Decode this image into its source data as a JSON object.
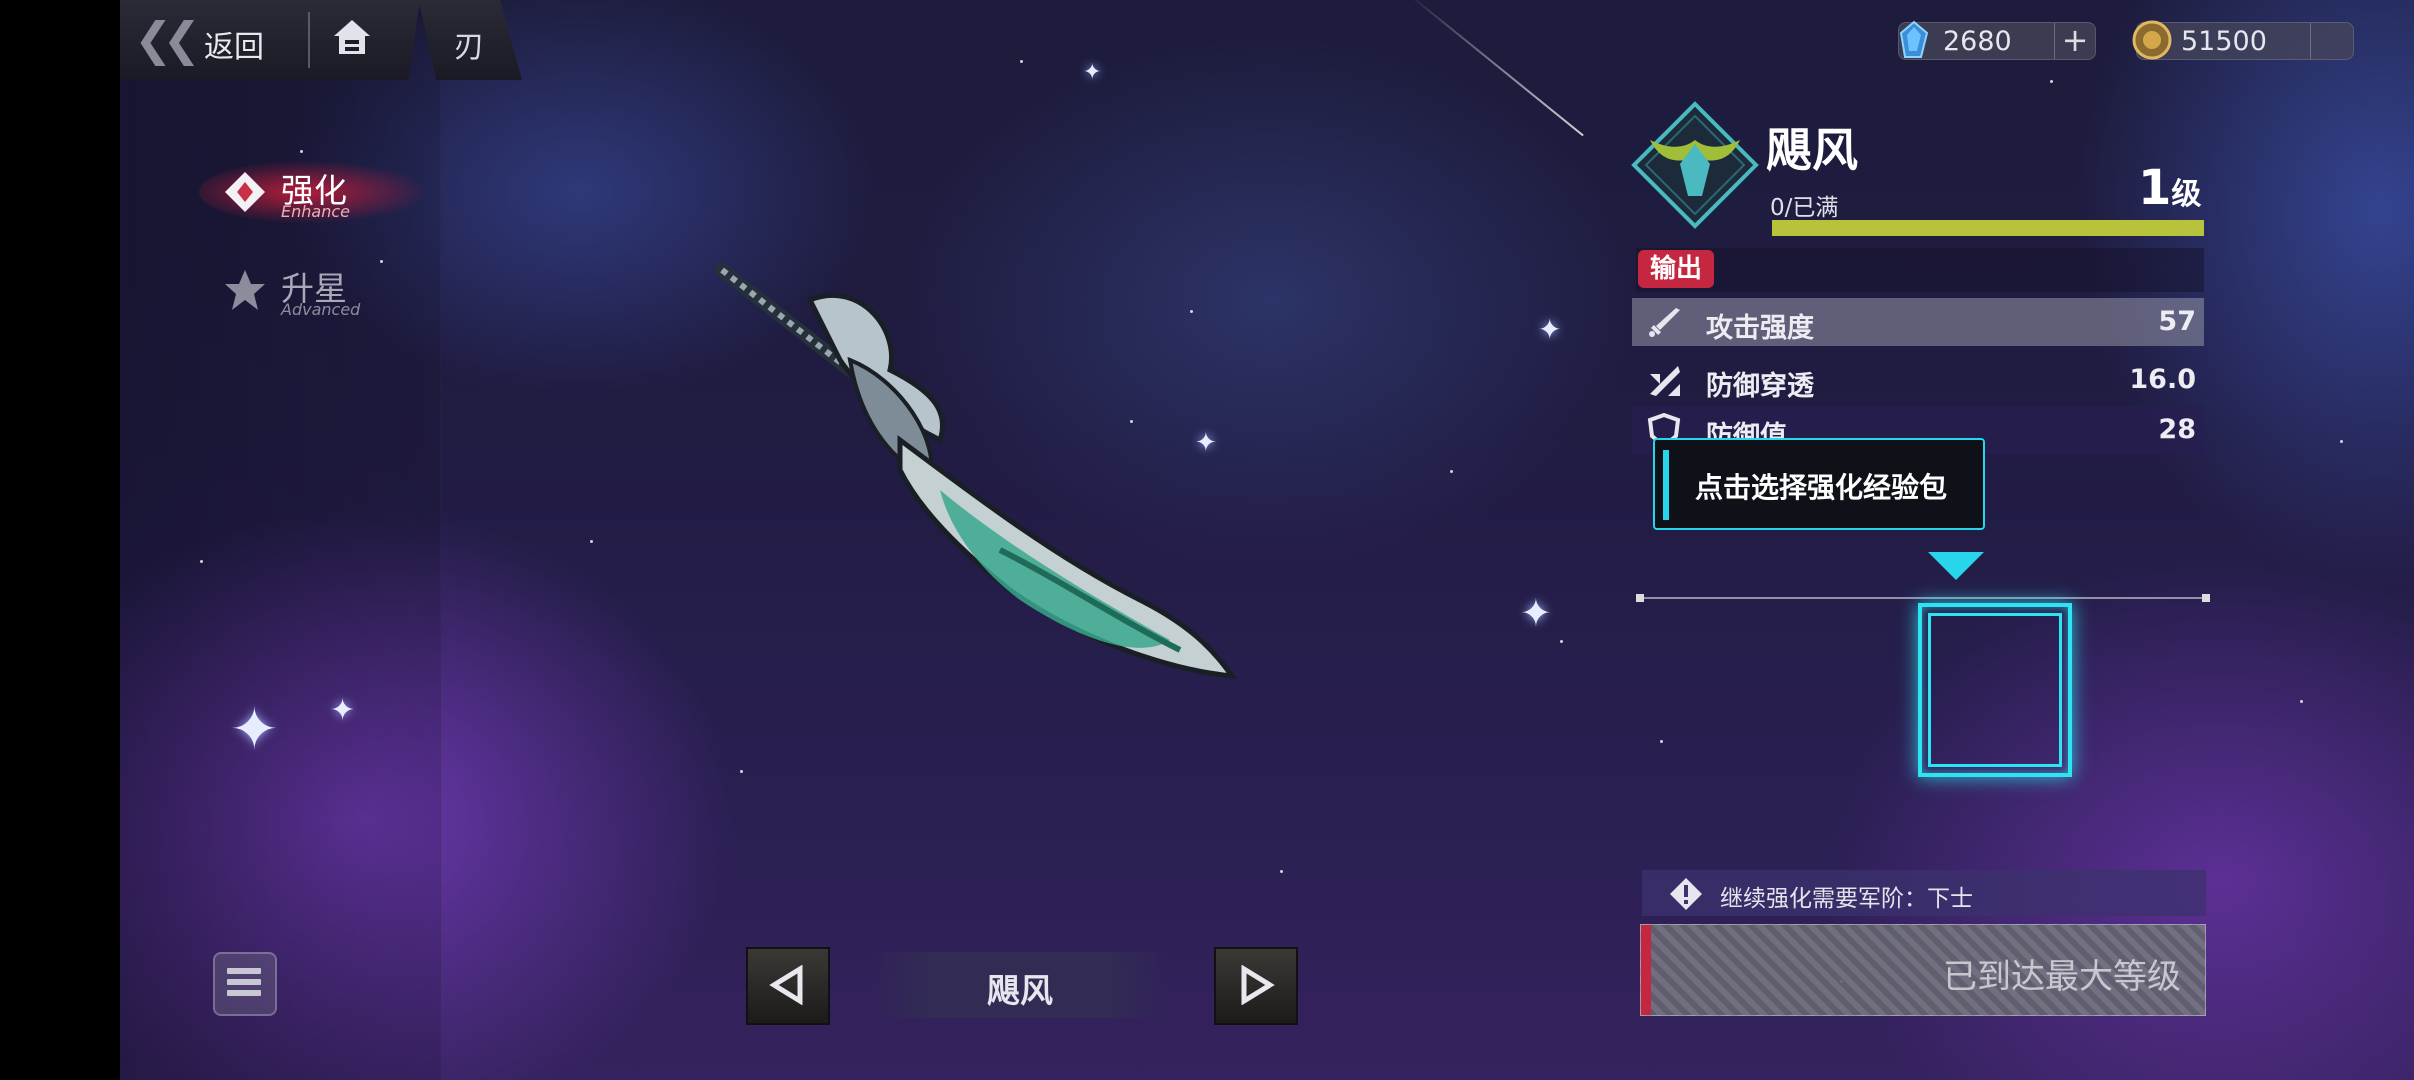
{
  "nav": {
    "back_label": "返回",
    "title": "刃"
  },
  "currencies": [
    {
      "icon": "crystal-icon",
      "value": "2680"
    },
    {
      "icon": "coin-icon",
      "value": "51500"
    }
  ],
  "tabs": [
    {
      "label_zh": "强化",
      "label_en": "Enhance",
      "active": true
    },
    {
      "label_zh": "升星",
      "label_en": "Advanced",
      "active": false
    }
  ],
  "weapon": {
    "name": "飓风",
    "exp_text": "0/已满",
    "level": "1",
    "level_suffix": "级",
    "exp_fill": 1.0,
    "role": "输出",
    "stats": [
      {
        "name": "攻击强度",
        "value": "57",
        "icon": "sword-icon"
      },
      {
        "name": "防御穿透",
        "value": "16.0",
        "icon": "pierce-icon"
      },
      {
        "name": "防御值",
        "value": "28",
        "icon": "shield-icon"
      }
    ]
  },
  "tooltip": "点击选择强化经验包",
  "requirement": "继续强化需要军阶：下士",
  "max_button": "已到达最大等级",
  "selector": {
    "name": "飓风"
  },
  "colors": {
    "accent_cyan": "#27d6ea",
    "role_red": "#c4273f",
    "exp_green": "#b8c23a"
  }
}
